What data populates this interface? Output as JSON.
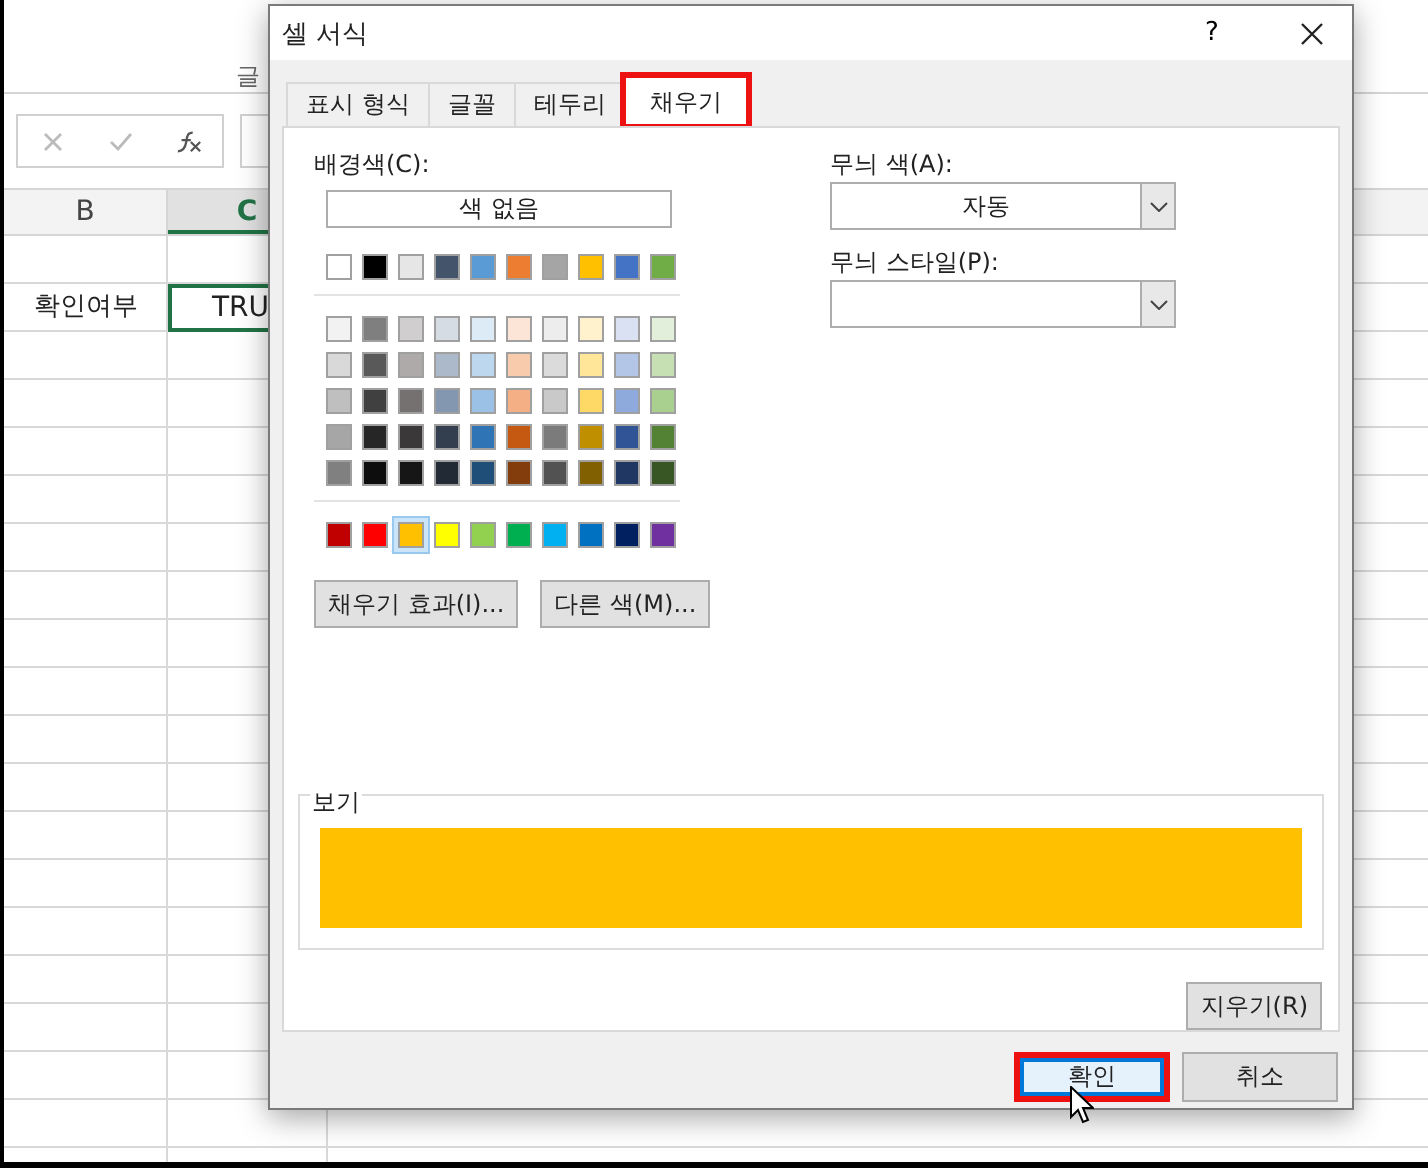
{
  "sheet": {
    "ribbon_group": "글",
    "columns": [
      {
        "label": "B",
        "selected": false
      },
      {
        "label": "C",
        "selected": true
      }
    ],
    "cells": [
      {
        "text": "확인여부",
        "selected": false
      },
      {
        "text": "TRU",
        "selected": true
      }
    ]
  },
  "window": {
    "title": "셀 서식",
    "help": "?"
  },
  "tabs": [
    {
      "label": "표시 형식",
      "selected": false,
      "highlighted": false
    },
    {
      "label": "글꼴",
      "selected": false,
      "highlighted": false
    },
    {
      "label": "테두리",
      "selected": false,
      "highlighted": false
    },
    {
      "label": "채우기",
      "selected": true,
      "highlighted": true
    }
  ],
  "fill": {
    "background_label": "배경색(C):",
    "no_color": "색 없음",
    "theme_colors": [
      {
        "color": "#ffffff",
        "selected": false
      },
      {
        "color": "#000000",
        "selected": false
      },
      {
        "color": "#e7e6e6",
        "selected": false
      },
      {
        "color": "#44546a",
        "selected": false
      },
      {
        "color": "#5b9bd5",
        "selected": false
      },
      {
        "color": "#ed7d31",
        "selected": false
      },
      {
        "color": "#a5a5a5",
        "selected": false
      },
      {
        "color": "#ffc000",
        "selected": false
      },
      {
        "color": "#4472c4",
        "selected": false
      },
      {
        "color": "#70ad47",
        "selected": false
      }
    ],
    "tint_rows": [
      [
        {
          "color": "#f2f2f2",
          "selected": false
        },
        {
          "color": "#7f7f7f",
          "selected": false
        },
        {
          "color": "#d0cece",
          "selected": false
        },
        {
          "color": "#d6dce4",
          "selected": false
        },
        {
          "color": "#ddebf7",
          "selected": false
        },
        {
          "color": "#fce4d6",
          "selected": false
        },
        {
          "color": "#ededed",
          "selected": false
        },
        {
          "color": "#fff2cc",
          "selected": false
        },
        {
          "color": "#d9e1f2",
          "selected": false
        },
        {
          "color": "#e2efda",
          "selected": false
        }
      ],
      [
        {
          "color": "#d9d9d9",
          "selected": false
        },
        {
          "color": "#595959",
          "selected": false
        },
        {
          "color": "#aeaaaa",
          "selected": false
        },
        {
          "color": "#acb9ca",
          "selected": false
        },
        {
          "color": "#bdd7ee",
          "selected": false
        },
        {
          "color": "#f8cbad",
          "selected": false
        },
        {
          "color": "#dbdbdb",
          "selected": false
        },
        {
          "color": "#ffe699",
          "selected": false
        },
        {
          "color": "#b4c6e7",
          "selected": false
        },
        {
          "color": "#c6e0b4",
          "selected": false
        }
      ],
      [
        {
          "color": "#bfbfbf",
          "selected": false
        },
        {
          "color": "#404040",
          "selected": false
        },
        {
          "color": "#757171",
          "selected": false
        },
        {
          "color": "#8497b0",
          "selected": false
        },
        {
          "color": "#9bc2e6",
          "selected": false
        },
        {
          "color": "#f4b084",
          "selected": false
        },
        {
          "color": "#c9c9c9",
          "selected": false
        },
        {
          "color": "#ffd966",
          "selected": false
        },
        {
          "color": "#8ea9db",
          "selected": false
        },
        {
          "color": "#a9d08e",
          "selected": false
        }
      ],
      [
        {
          "color": "#a6a6a6",
          "selected": false
        },
        {
          "color": "#262626",
          "selected": false
        },
        {
          "color": "#3a3838",
          "selected": false
        },
        {
          "color": "#333f4f",
          "selected": false
        },
        {
          "color": "#2f75b5",
          "selected": false
        },
        {
          "color": "#c65911",
          "selected": false
        },
        {
          "color": "#7b7b7b",
          "selected": false
        },
        {
          "color": "#bf8f00",
          "selected": false
        },
        {
          "color": "#305496",
          "selected": false
        },
        {
          "color": "#548235",
          "selected": false
        }
      ],
      [
        {
          "color": "#808080",
          "selected": false
        },
        {
          "color": "#0d0d0d",
          "selected": false
        },
        {
          "color": "#161616",
          "selected": false
        },
        {
          "color": "#222b35",
          "selected": false
        },
        {
          "color": "#1f4e78",
          "selected": false
        },
        {
          "color": "#833c0c",
          "selected": false
        },
        {
          "color": "#525252",
          "selected": false
        },
        {
          "color": "#806000",
          "selected": false
        },
        {
          "color": "#203764",
          "selected": false
        },
        {
          "color": "#375623",
          "selected": false
        }
      ]
    ],
    "standard_colors": [
      {
        "color": "#c00000",
        "selected": false
      },
      {
        "color": "#ff0000",
        "selected": false
      },
      {
        "color": "#ffc000",
        "selected": true
      },
      {
        "color": "#ffff00",
        "selected": false
      },
      {
        "color": "#92d050",
        "selected": false
      },
      {
        "color": "#00b050",
        "selected": false
      },
      {
        "color": "#00b0f0",
        "selected": false
      },
      {
        "color": "#0070c0",
        "selected": false
      },
      {
        "color": "#002060",
        "selected": false
      },
      {
        "color": "#7030a0",
        "selected": false
      }
    ],
    "effects_button": "채우기 효과(I)...",
    "more_colors_button": "다른 색(M)...",
    "pattern_color_label": "무늬 색(A):",
    "pattern_color": "자동",
    "pattern_style_label": "무늬 스타일(P):",
    "preview_label": "보기",
    "clear_button": "지우기(R)"
  },
  "buttons": [
    {
      "label": "확인",
      "highlighted": true,
      "default": true
    },
    {
      "label": "취소",
      "highlighted": false,
      "default": false
    }
  ]
}
